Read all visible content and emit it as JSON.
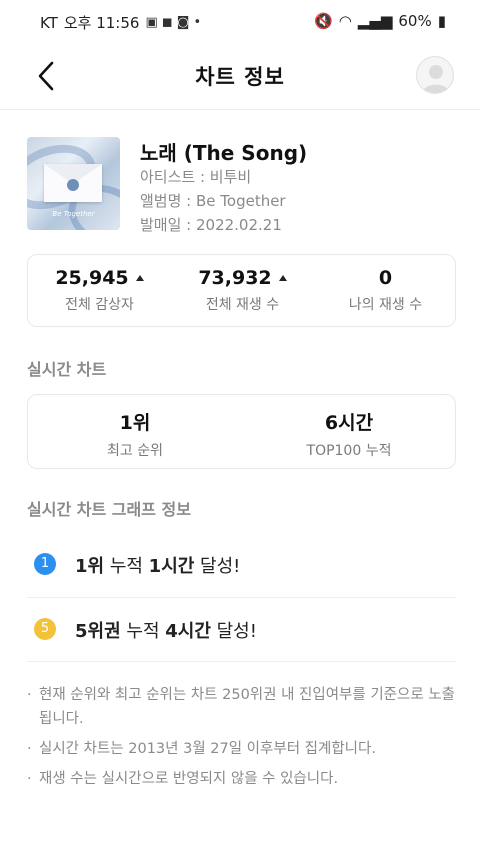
{
  "status_bar": {
    "carrier": "KT",
    "time": "오후 11:56",
    "battery": "60%"
  },
  "header": {
    "title": "차트 정보"
  },
  "song": {
    "title": "노래 (The Song)",
    "artist": "아티스트 : 비투비",
    "album": "앨범명 : Be Together",
    "release": "발매일 : 2022.02.21",
    "cover_text": "Be Together"
  },
  "stats": [
    {
      "value": "25,945",
      "label": "전체 감상자",
      "trend": "up"
    },
    {
      "value": "73,932",
      "label": "전체 재생 수",
      "trend": "up"
    },
    {
      "value": "0",
      "label": "나의 재생 수",
      "trend": "none"
    }
  ],
  "realtime": {
    "section_title": "실시간 차트",
    "items": [
      {
        "value": "1위",
        "label": "최고 순위"
      },
      {
        "value": "6시간",
        "label": "TOP100 누적"
      }
    ]
  },
  "graph": {
    "section_title": "실시간 차트 그래프 정보",
    "achievements": [
      {
        "badge": "1",
        "badge_color": "#2b8ff0",
        "rank": "1위",
        "mid": " 누적 ",
        "hours": "1시간",
        "suffix": " 달성!"
      },
      {
        "badge": "5",
        "badge_color": "#f2c23a",
        "rank": "5위권",
        "mid": " 누적 ",
        "hours": "4시간",
        "suffix": " 달성!"
      }
    ]
  },
  "notes": [
    "현재 순위와 최고 순위는 차트 250위권 내 진입여부를 기준으로 노출됩니다.",
    "실시간 차트는 2013년 3월 27일 이후부터 집계합니다.",
    "재생 수는 실시간으로 반영되지 않을 수 있습니다."
  ]
}
